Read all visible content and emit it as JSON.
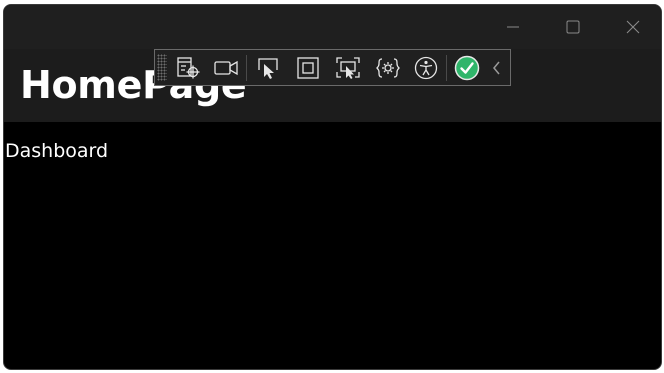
{
  "window": {
    "caption_buttons": [
      {
        "name": "minimize",
        "icon": "minimize-icon"
      },
      {
        "name": "maximize",
        "icon": "maximize-icon"
      },
      {
        "name": "close",
        "icon": "close-icon"
      }
    ]
  },
  "header": {
    "title": "HomePage"
  },
  "main": {
    "label": "Dashboard"
  },
  "debug_toolbar": {
    "tools": [
      "live-visual-tree-icon",
      "video-camera-icon",
      "select-element-icon",
      "display-layout-adorners-icon",
      "track-focused-element-icon",
      "binding-failures-icon",
      "accessibility-icon",
      "hot-reload-status-icon",
      "collapse-chevron-icon"
    ],
    "status_color": "#2fb56a"
  },
  "colors": {
    "titlebar": "#1f1f1f",
    "header": "#1c1c1c",
    "background": "#000000",
    "text": "#ffffff"
  }
}
